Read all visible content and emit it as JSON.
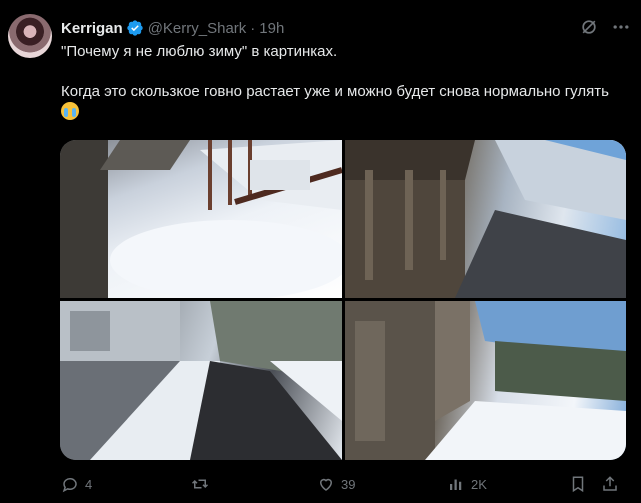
{
  "post": {
    "author_name": "Kerrigan",
    "handle": "@Kerry_Shark",
    "separator": "·",
    "time": "19h",
    "text_line1": "\"Почему я не люблю зиму\" в картинках.",
    "text_line2": "Когда это скользкое говно растает уже и можно будет снова нормально гулять",
    "emoji_name": "loudly-crying-face"
  },
  "actions": {
    "replies": "4",
    "reposts": "",
    "likes": "39",
    "views": "2K"
  },
  "colors": {
    "background": "#000000",
    "text": "#e7e9ea",
    "muted": "#71767b",
    "verified": "#1d9bf0"
  }
}
